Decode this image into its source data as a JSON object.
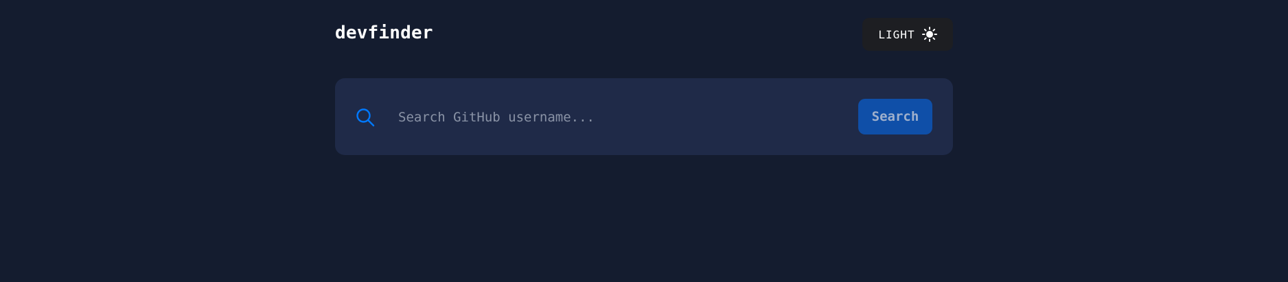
{
  "header": {
    "logo": "devfinder",
    "theme_toggle_label": "LIGHT",
    "theme_icon": "sun-icon"
  },
  "search": {
    "placeholder": "Search GitHub username...",
    "value": "",
    "button_label": "Search",
    "icon": "search-icon"
  },
  "colors": {
    "background": "#141c2f",
    "card": "#1f2a48",
    "accent": "#0079ff",
    "button": "#0f4fa8",
    "toggle_bg": "#1d1e22",
    "text": "#ffffff",
    "placeholder": "#8a93a6"
  }
}
